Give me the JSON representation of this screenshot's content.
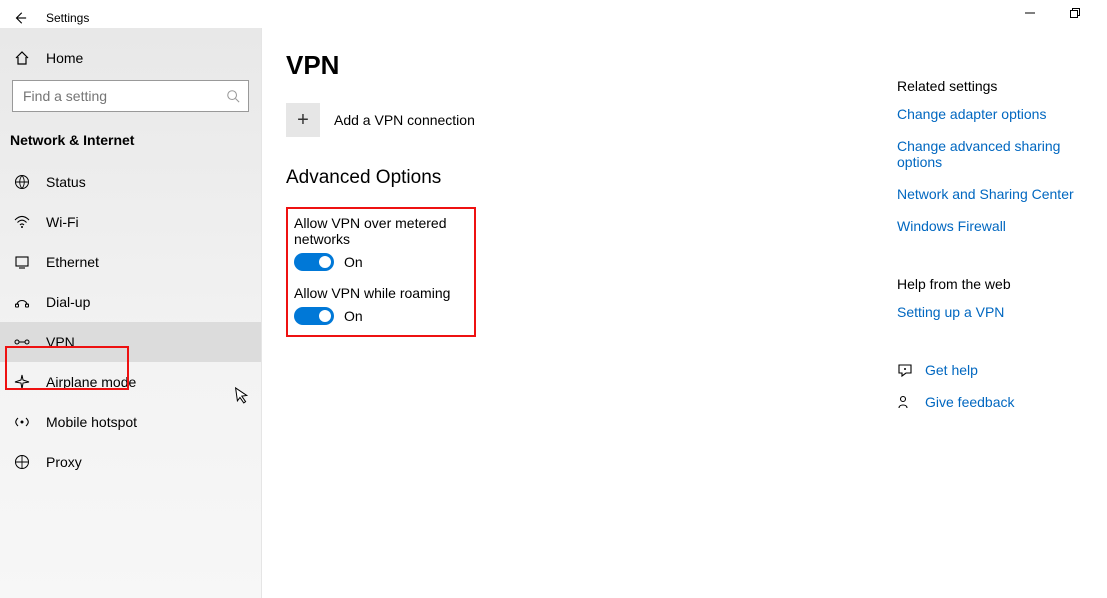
{
  "window": {
    "title": "Settings"
  },
  "sidebar": {
    "home": "Home",
    "search_placeholder": "Find a setting",
    "category": "Network & Internet",
    "items": [
      {
        "label": "Status"
      },
      {
        "label": "Wi-Fi"
      },
      {
        "label": "Ethernet"
      },
      {
        "label": "Dial-up"
      },
      {
        "label": "VPN"
      },
      {
        "label": "Airplane mode"
      },
      {
        "label": "Mobile hotspot"
      },
      {
        "label": "Proxy"
      }
    ]
  },
  "main": {
    "title": "VPN",
    "add_label": "Add a VPN connection",
    "advanced_heading": "Advanced Options",
    "opts": [
      {
        "label": "Allow VPN over metered networks",
        "state": "On"
      },
      {
        "label": "Allow VPN while roaming",
        "state": "On"
      }
    ]
  },
  "right": {
    "related_heading": "Related settings",
    "links": [
      "Change adapter options",
      "Change advanced sharing options",
      "Network and Sharing Center",
      "Windows Firewall"
    ],
    "help_heading": "Help from the web",
    "help_links": [
      "Setting up a VPN"
    ],
    "get_help": "Get help",
    "give_feedback": "Give feedback"
  }
}
